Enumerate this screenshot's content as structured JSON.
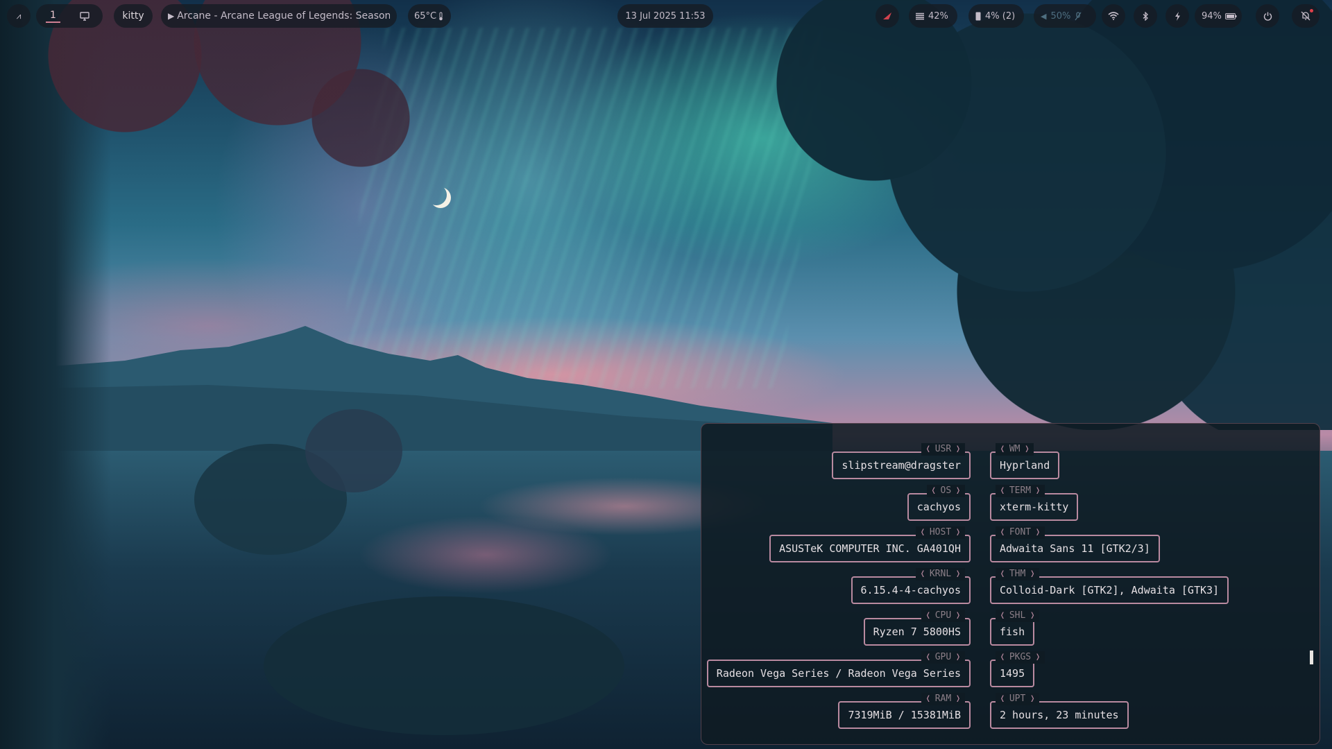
{
  "bar": {
    "workspace": "1",
    "active_window_class": "kitty",
    "media_title": "Arcane - Arcane League of Legends: Season...",
    "media_play_icon": "▶",
    "temperature": "65°C",
    "datetime": "13 Jul 2025 11:53",
    "memory": "42%",
    "cpu": "4% (2)",
    "volume": "50%",
    "battery": "94%"
  },
  "fetch": {
    "left": [
      {
        "label": "USR",
        "value": "slipstream@dragster"
      },
      {
        "label": "OS",
        "value": "cachyos"
      },
      {
        "label": "HOST",
        "value": "ASUSTeK COMPUTER INC. GA401QH"
      },
      {
        "label": "KRNL",
        "value": "6.15.4-4-cachyos"
      },
      {
        "label": "CPU",
        "value": "Ryzen 7 5800HS"
      },
      {
        "label": "GPU",
        "value": "Radeon Vega Series / Radeon Vega Series"
      },
      {
        "label": "RAM",
        "value": "7319MiB / 15381MiB"
      }
    ],
    "right": [
      {
        "label": "WM",
        "value": "Hyprland"
      },
      {
        "label": "TERM",
        "value": "xterm-kitty"
      },
      {
        "label": "FONT",
        "value": "Adwaita Sans 11 [GTK2/3]"
      },
      {
        "label": "THM",
        "value": "Colloid-Dark [GTK2], Adwaita [GTK3]"
      },
      {
        "label": "SHL",
        "value": "fish"
      },
      {
        "label": "PKGS",
        "value": "1495"
      },
      {
        "label": "UPT",
        "value": "2 hours, 23 minutes"
      }
    ]
  },
  "colors": {
    "accent": "#b98aa0",
    "bar_bg": "#161c24",
    "terminal_bg": "#0f1b23",
    "notification_dot": "#e0404a"
  }
}
